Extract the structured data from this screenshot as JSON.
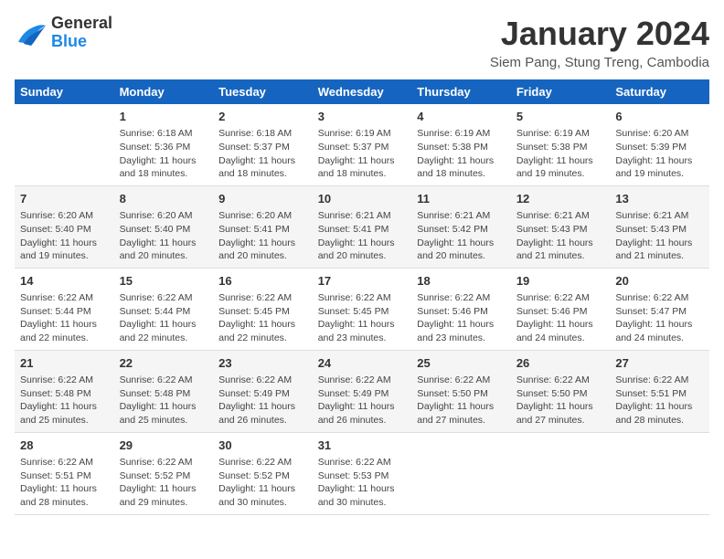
{
  "header": {
    "logo_general": "General",
    "logo_blue": "Blue",
    "month_year": "January 2024",
    "location": "Siem Pang, Stung Treng, Cambodia"
  },
  "weekdays": [
    "Sunday",
    "Monday",
    "Tuesday",
    "Wednesday",
    "Thursday",
    "Friday",
    "Saturday"
  ],
  "weeks": [
    [
      {
        "num": "",
        "sunrise": "",
        "sunset": "",
        "daylight": ""
      },
      {
        "num": "1",
        "sunrise": "Sunrise: 6:18 AM",
        "sunset": "Sunset: 5:36 PM",
        "daylight": "Daylight: 11 hours and 18 minutes."
      },
      {
        "num": "2",
        "sunrise": "Sunrise: 6:18 AM",
        "sunset": "Sunset: 5:37 PM",
        "daylight": "Daylight: 11 hours and 18 minutes."
      },
      {
        "num": "3",
        "sunrise": "Sunrise: 6:19 AM",
        "sunset": "Sunset: 5:37 PM",
        "daylight": "Daylight: 11 hours and 18 minutes."
      },
      {
        "num": "4",
        "sunrise": "Sunrise: 6:19 AM",
        "sunset": "Sunset: 5:38 PM",
        "daylight": "Daylight: 11 hours and 18 minutes."
      },
      {
        "num": "5",
        "sunrise": "Sunrise: 6:19 AM",
        "sunset": "Sunset: 5:38 PM",
        "daylight": "Daylight: 11 hours and 19 minutes."
      },
      {
        "num": "6",
        "sunrise": "Sunrise: 6:20 AM",
        "sunset": "Sunset: 5:39 PM",
        "daylight": "Daylight: 11 hours and 19 minutes."
      }
    ],
    [
      {
        "num": "7",
        "sunrise": "Sunrise: 6:20 AM",
        "sunset": "Sunset: 5:40 PM",
        "daylight": "Daylight: 11 hours and 19 minutes."
      },
      {
        "num": "8",
        "sunrise": "Sunrise: 6:20 AM",
        "sunset": "Sunset: 5:40 PM",
        "daylight": "Daylight: 11 hours and 20 minutes."
      },
      {
        "num": "9",
        "sunrise": "Sunrise: 6:20 AM",
        "sunset": "Sunset: 5:41 PM",
        "daylight": "Daylight: 11 hours and 20 minutes."
      },
      {
        "num": "10",
        "sunrise": "Sunrise: 6:21 AM",
        "sunset": "Sunset: 5:41 PM",
        "daylight": "Daylight: 11 hours and 20 minutes."
      },
      {
        "num": "11",
        "sunrise": "Sunrise: 6:21 AM",
        "sunset": "Sunset: 5:42 PM",
        "daylight": "Daylight: 11 hours and 20 minutes."
      },
      {
        "num": "12",
        "sunrise": "Sunrise: 6:21 AM",
        "sunset": "Sunset: 5:43 PM",
        "daylight": "Daylight: 11 hours and 21 minutes."
      },
      {
        "num": "13",
        "sunrise": "Sunrise: 6:21 AM",
        "sunset": "Sunset: 5:43 PM",
        "daylight": "Daylight: 11 hours and 21 minutes."
      }
    ],
    [
      {
        "num": "14",
        "sunrise": "Sunrise: 6:22 AM",
        "sunset": "Sunset: 5:44 PM",
        "daylight": "Daylight: 11 hours and 22 minutes."
      },
      {
        "num": "15",
        "sunrise": "Sunrise: 6:22 AM",
        "sunset": "Sunset: 5:44 PM",
        "daylight": "Daylight: 11 hours and 22 minutes."
      },
      {
        "num": "16",
        "sunrise": "Sunrise: 6:22 AM",
        "sunset": "Sunset: 5:45 PM",
        "daylight": "Daylight: 11 hours and 22 minutes."
      },
      {
        "num": "17",
        "sunrise": "Sunrise: 6:22 AM",
        "sunset": "Sunset: 5:45 PM",
        "daylight": "Daylight: 11 hours and 23 minutes."
      },
      {
        "num": "18",
        "sunrise": "Sunrise: 6:22 AM",
        "sunset": "Sunset: 5:46 PM",
        "daylight": "Daylight: 11 hours and 23 minutes."
      },
      {
        "num": "19",
        "sunrise": "Sunrise: 6:22 AM",
        "sunset": "Sunset: 5:46 PM",
        "daylight": "Daylight: 11 hours and 24 minutes."
      },
      {
        "num": "20",
        "sunrise": "Sunrise: 6:22 AM",
        "sunset": "Sunset: 5:47 PM",
        "daylight": "Daylight: 11 hours and 24 minutes."
      }
    ],
    [
      {
        "num": "21",
        "sunrise": "Sunrise: 6:22 AM",
        "sunset": "Sunset: 5:48 PM",
        "daylight": "Daylight: 11 hours and 25 minutes."
      },
      {
        "num": "22",
        "sunrise": "Sunrise: 6:22 AM",
        "sunset": "Sunset: 5:48 PM",
        "daylight": "Daylight: 11 hours and 25 minutes."
      },
      {
        "num": "23",
        "sunrise": "Sunrise: 6:22 AM",
        "sunset": "Sunset: 5:49 PM",
        "daylight": "Daylight: 11 hours and 26 minutes."
      },
      {
        "num": "24",
        "sunrise": "Sunrise: 6:22 AM",
        "sunset": "Sunset: 5:49 PM",
        "daylight": "Daylight: 11 hours and 26 minutes."
      },
      {
        "num": "25",
        "sunrise": "Sunrise: 6:22 AM",
        "sunset": "Sunset: 5:50 PM",
        "daylight": "Daylight: 11 hours and 27 minutes."
      },
      {
        "num": "26",
        "sunrise": "Sunrise: 6:22 AM",
        "sunset": "Sunset: 5:50 PM",
        "daylight": "Daylight: 11 hours and 27 minutes."
      },
      {
        "num": "27",
        "sunrise": "Sunrise: 6:22 AM",
        "sunset": "Sunset: 5:51 PM",
        "daylight": "Daylight: 11 hours and 28 minutes."
      }
    ],
    [
      {
        "num": "28",
        "sunrise": "Sunrise: 6:22 AM",
        "sunset": "Sunset: 5:51 PM",
        "daylight": "Daylight: 11 hours and 28 minutes."
      },
      {
        "num": "29",
        "sunrise": "Sunrise: 6:22 AM",
        "sunset": "Sunset: 5:52 PM",
        "daylight": "Daylight: 11 hours and 29 minutes."
      },
      {
        "num": "30",
        "sunrise": "Sunrise: 6:22 AM",
        "sunset": "Sunset: 5:52 PM",
        "daylight": "Daylight: 11 hours and 30 minutes."
      },
      {
        "num": "31",
        "sunrise": "Sunrise: 6:22 AM",
        "sunset": "Sunset: 5:53 PM",
        "daylight": "Daylight: 11 hours and 30 minutes."
      },
      {
        "num": "",
        "sunrise": "",
        "sunset": "",
        "daylight": ""
      },
      {
        "num": "",
        "sunrise": "",
        "sunset": "",
        "daylight": ""
      },
      {
        "num": "",
        "sunrise": "",
        "sunset": "",
        "daylight": ""
      }
    ]
  ]
}
